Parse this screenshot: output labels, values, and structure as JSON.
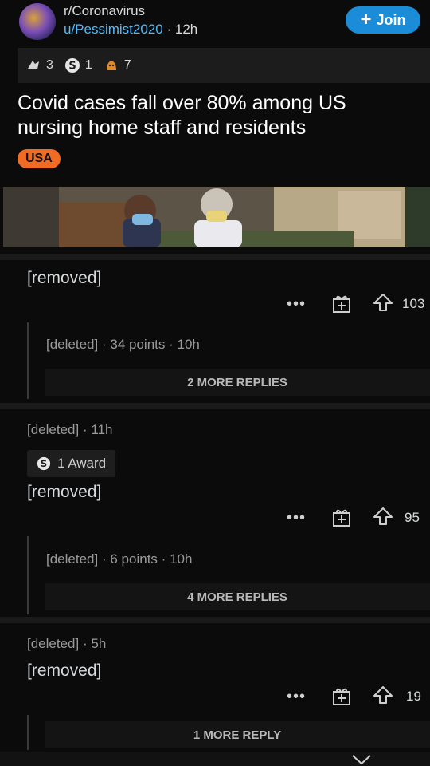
{
  "post": {
    "subreddit": "r/Coronavirus",
    "author": "u/Pessimist2020",
    "separator": "·",
    "age": "12h",
    "join_label": "Join",
    "awards": [
      {
        "icon": "helpful-award-icon",
        "count": "3"
      },
      {
        "icon": "silver-award-icon",
        "count": "1"
      },
      {
        "icon": "wholesome-award-icon",
        "count": "7"
      }
    ],
    "title": "Covid cases fall over 80% among US nursing home staff and residents",
    "flair": "USA"
  },
  "comments": [
    {
      "body": "[removed]",
      "score": "103",
      "reply": {
        "author": "[deleted]",
        "points": "34 points",
        "age": "10h"
      },
      "more_replies": "2 MORE REPLIES"
    },
    {
      "author": "[deleted]",
      "age": "11h",
      "award": "1 Award",
      "body": "[removed]",
      "score": "95",
      "reply": {
        "author": "[deleted]",
        "points": "6 points",
        "age": "10h"
      },
      "more_replies": "4 MORE REPLIES"
    },
    {
      "author": "[deleted]",
      "age": "5h",
      "body": "[removed]",
      "score": "19",
      "more_replies": "1 MORE REPLY"
    }
  ],
  "colors": {
    "accent": "#1a8cd8",
    "flair": "#f26b22",
    "link": "#4fbcff"
  }
}
